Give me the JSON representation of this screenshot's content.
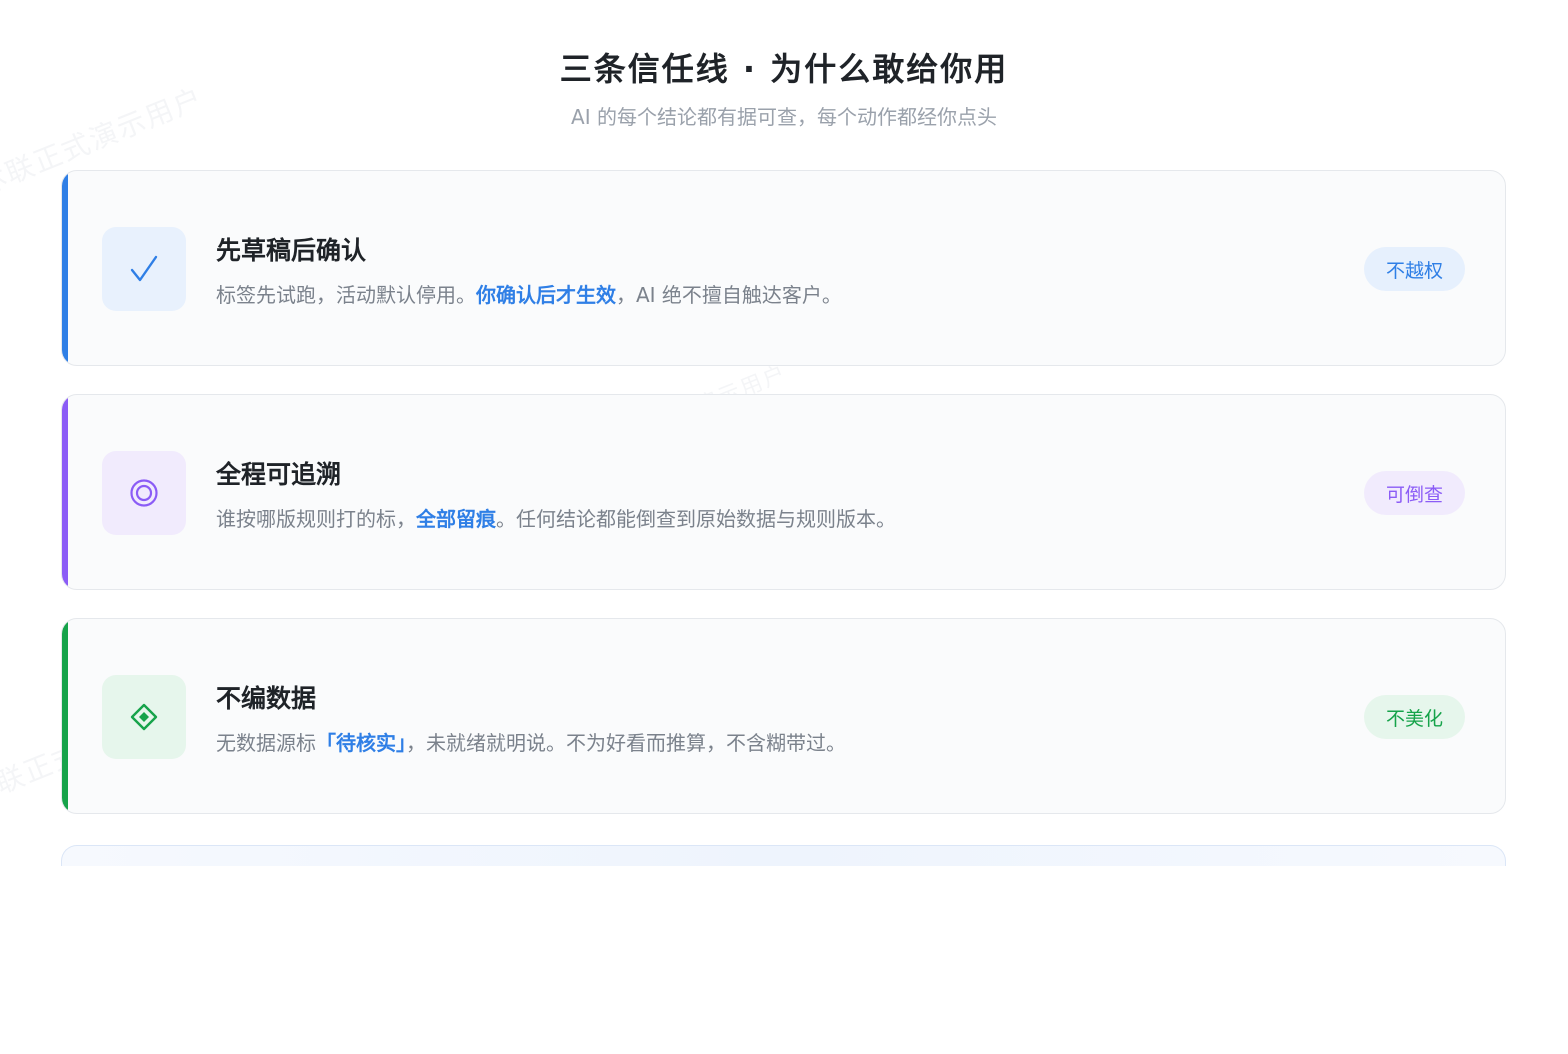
{
  "header": {
    "title": "三条信任线 · 为什么敢给你用",
    "subtitle": "AI 的每个结论都有据可查，每个动作都经你点头"
  },
  "watermark": "沐联正式演示用户",
  "cards": [
    {
      "title": "先草稿后确认",
      "desc_pre": "标签先试跑，活动默认停用。",
      "desc_highlight": "你确认后才生效",
      "desc_post": "，AI 绝不擅自触达客户。",
      "badge": "不越权",
      "icon": "check-icon",
      "accent": "#2f7fe6"
    },
    {
      "title": "全程可追溯",
      "desc_pre": "谁按哪版规则打的标，",
      "desc_highlight": "全部留痕",
      "desc_post": "。任何结论都能倒查到原始数据与规则版本。",
      "badge": "可倒查",
      "icon": "target-icon",
      "accent": "#8b5cf6"
    },
    {
      "title": "不编数据",
      "desc_pre": "无数据源标",
      "desc_highlight": "「待核实」",
      "desc_post": "，未就绪就明说。不为好看而推算，不含糊带过。",
      "badge": "不美化",
      "icon": "diamond-icon",
      "accent": "#16a34a"
    }
  ]
}
